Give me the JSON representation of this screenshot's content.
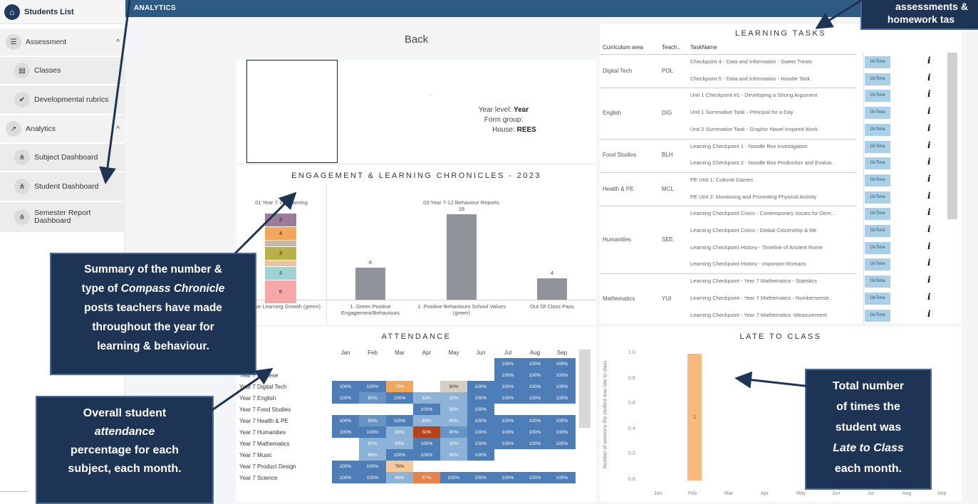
{
  "sidebar": {
    "students_list": "Students List",
    "assessment": "Assessment",
    "classes": "Classes",
    "dev_rubrics": "Developmental rubrics",
    "analytics": "Analytics",
    "subject_dashboard": "Subject Dashboard",
    "student_dashboard": "Student Dashboard",
    "semester_report": "Semester Report Dashboard"
  },
  "topbar": {
    "title": "ANALYTICS"
  },
  "back": "Back",
  "profile": {
    "year_level_label": "Year level:",
    "year_level_value": "Year",
    "form_group_label": "Form group:",
    "house_label": "House:",
    "house_value": "REES",
    "dot": "."
  },
  "engagement": {
    "title": "ENGAGEMENT & LEARNING CHRONICLES - 2023",
    "left_sub": "01 Year 7-10 Learning",
    "right_sub": "03 Year 7-12 Behaviour Reports",
    "left_axis_label": "Positive Learning Growth (green)",
    "stack_segments": [
      "3",
      "4",
      "",
      "3",
      "",
      "3",
      "6"
    ],
    "colors": [
      "#9b7c9b",
      "#f2a65a",
      "#c7b9a8",
      "#b9b04a",
      "#e8c5a0",
      "#9fd3d3",
      "#f6a7a7"
    ]
  },
  "chart_data": {
    "type": "bar",
    "title": "03 Year 7-12 Behaviour Reports",
    "categories": [
      "1. Green Positive Engagement/Behaviours",
      "1. Positive Behaviours School Values (green)",
      "Out Of Class Pass"
    ],
    "values": [
      6,
      16,
      4
    ]
  },
  "learning_tasks": {
    "title": "LEARNING TASKS",
    "headers": [
      "Curriculum area",
      "Teach..",
      "TaskName"
    ],
    "status": "OnTime",
    "info": "i",
    "groups": [
      {
        "area": "Digital Tech",
        "teacher": "POL",
        "tasks": [
          "Checkpoint 4 - Data and Information - Sweet Treats",
          "Checkpoint 5 - Data and Information - Hoodie Task"
        ]
      },
      {
        "area": "English",
        "teacher": "DIG",
        "tasks": [
          "Unit 1 Checkpoint #1 - Developing a Strong Argument",
          "Unit 1 Summative Task - Principal for a Day",
          "Unit 2 Summative Task - Graphic Novel Inspired Work"
        ]
      },
      {
        "area": "Food Studies",
        "teacher": "BLH",
        "tasks": [
          "Learning Checkpoint 1 - Noodle Box Investigation",
          "Learning Checkpoint 2 - Noodle Box Production and Evalua.."
        ]
      },
      {
        "area": "Health & PE",
        "teacher": "MCL",
        "tasks": [
          "PE Unit 1: Cultural Games",
          "PE Unit 2: Monitoring and Promoting Physical Activity"
        ]
      },
      {
        "area": "Humanities",
        "teacher": "SEE",
        "tasks": [
          "Learning Checkpoint Civics - Contemporary Issues for Dem..",
          "Learning Checkpoint Civics - Global Citizenship & Me",
          "Learning Checkpoint History - Timeline of Ancient Rome",
          "Learning Checkpoint History - Important Romans"
        ]
      },
      {
        "area": "Mathematics",
        "teacher": "YUI",
        "tasks": [
          "Learning Checkpoint - Year 7 Mathematics - Statistics",
          "Learning Checkpoint - Year 7 Mathematics - Numbersense..",
          "Learning Checkpoint - Year 7 Mathematics -Measurement"
        ]
      }
    ]
  },
  "attendance": {
    "title": "ATTENDANCE",
    "months": [
      "Jan",
      "Feb",
      "Mar",
      "Apr",
      "May",
      "Jun",
      "Jul",
      "Aug",
      "Sep"
    ],
    "rows": [
      {
        "subject": "Art",
        "cells": [
          "",
          "",
          "",
          "",
          "",
          "",
          "100%",
          "100%",
          "100%"
        ],
        "cls": [
          "",
          "",
          "",
          "",
          "",
          "",
          "c1",
          "c1",
          "c1"
        ]
      },
      {
        "subject": "Year 7 Chinese",
        "cells": [
          "",
          "",
          "",
          "",
          "",
          "",
          "100%",
          "100%",
          "100%"
        ],
        "cls": [
          "",
          "",
          "",
          "",
          "",
          "",
          "c1",
          "c1",
          "c1"
        ]
      },
      {
        "subject": "Year 7 Digital Tech",
        "cells": [
          "100%",
          "100%",
          "75%",
          "",
          "80%",
          "100%",
          "100%",
          "100%",
          "100%"
        ],
        "cls": [
          "c1",
          "c1",
          "c4",
          "",
          "c5",
          "c1",
          "c1",
          "c1",
          "c1"
        ]
      },
      {
        "subject": "Year 7 English",
        "cells": [
          "100%",
          "90%",
          "100%",
          "83%",
          "93%",
          "100%",
          "100%",
          "100%",
          "100%"
        ],
        "cls": [
          "c1",
          "c2",
          "c1",
          "c3",
          "c3",
          "c1",
          "c1",
          "c1",
          "c1"
        ]
      },
      {
        "subject": "Year 7 Food Studies",
        "cells": [
          "",
          "",
          "",
          "100%",
          "89%",
          "100%",
          "",
          "",
          ""
        ],
        "cls": [
          "",
          "",
          "",
          "c1",
          "c3",
          "c1",
          "",
          "",
          ""
        ]
      },
      {
        "subject": "Year 7 Health & PE",
        "cells": [
          "100%",
          "90%",
          "100%",
          "83%",
          "93%",
          "100%",
          "100%",
          "100%",
          "100%"
        ],
        "cls": [
          "c1",
          "c2",
          "c1",
          "c3",
          "c3",
          "c1",
          "c1",
          "c1",
          "c1"
        ]
      },
      {
        "subject": "Year 7 Humanities",
        "cells": [
          "100%",
          "100%",
          "83%",
          "50%",
          "90%",
          "100%",
          "100%",
          "100%",
          "100%"
        ],
        "cls": [
          "c1",
          "c1",
          "c3",
          "c6",
          "c2",
          "c1",
          "c1",
          "c1",
          "c1"
        ]
      },
      {
        "subject": "Year 7 Mathematics",
        "cells": [
          "",
          "91%",
          "93%",
          "100%",
          "92%",
          "100%",
          "100%",
          "100%",
          "100%"
        ],
        "cls": [
          "",
          "c3",
          "c3",
          "c1",
          "c3",
          "c1",
          "c1",
          "c1",
          "c1"
        ]
      },
      {
        "subject": "Year 7 Music",
        "cells": [
          "",
          "86%",
          "100%",
          "100%",
          "89%",
          "100%",
          "",
          "",
          ""
        ],
        "cls": [
          "",
          "c3",
          "c1",
          "c1",
          "c3",
          "c1",
          "",
          "",
          ""
        ]
      },
      {
        "subject": "Year 7 Product Design",
        "cells": [
          "100%",
          "100%",
          "78%",
          "",
          "",
          "",
          "",
          "",
          ""
        ],
        "cls": [
          "c1",
          "c1",
          "c8",
          "",
          "",
          "",
          "",
          "",
          ""
        ]
      },
      {
        "subject": "Year 7 Science",
        "cells": [
          "100%",
          "100%",
          "86%",
          "67%",
          "100%",
          "100%",
          "100%",
          "100%",
          "100%"
        ],
        "cls": [
          "c1",
          "c1",
          "c3",
          "c7",
          "c1",
          "c1",
          "c1",
          "c1",
          "c1"
        ]
      }
    ]
  },
  "late": {
    "title": "LATE TO CLASS",
    "y_title": "Number of sessions the student was late to class",
    "y_ticks": [
      "1.0",
      "0.8",
      "0.6",
      "0.4",
      "0.2",
      "0.0"
    ],
    "months": [
      "Jan",
      "Feb",
      "Mar",
      "Apr",
      "May",
      "Jun",
      "Jul",
      "Aug",
      "Sep"
    ],
    "values": [
      0,
      1,
      0,
      0,
      0,
      0,
      0,
      0,
      0
    ],
    "bar_label": "1"
  },
  "callouts": {
    "top_right_1": "assessments &",
    "top_right_2": "homework tas",
    "chron_1": "Summary of the number &",
    "chron_2a": "type of ",
    "chron_2b": "Compass Chronicle",
    "chron_3": "posts teachers have made",
    "chron_4": "throughout the year for",
    "chron_5": "learning & behaviour.",
    "att_1": "Overall student",
    "att_2": "attendance",
    "att_3": "percentage for each",
    "att_4": "subject, each month.",
    "late_1": "Total number",
    "late_2": "of times the",
    "late_3": "student was",
    "late_4": "Late to Class",
    "late_5": "each month."
  }
}
